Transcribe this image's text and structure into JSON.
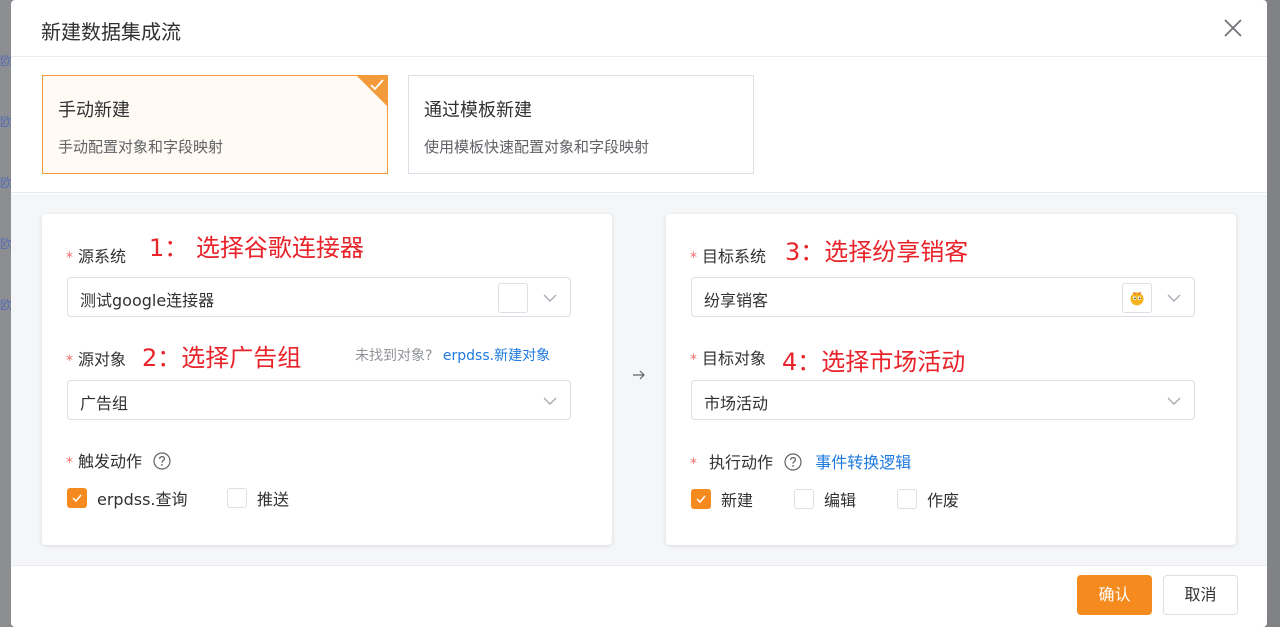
{
  "modal": {
    "title": "新建数据集成流"
  },
  "background_chars": [
    "欧",
    "欧",
    "欧",
    "欧",
    "欧"
  ],
  "modes": [
    {
      "title": "手动新建",
      "desc": "手动配置对象和字段映射",
      "selected": true
    },
    {
      "title": "通过模板新建",
      "desc": "使用模板快速配置对象和字段映射",
      "selected": false
    }
  ],
  "source": {
    "system_label": "源系统",
    "system_annotation": "1： 选择谷歌连接器",
    "system_value": "测试google连接器",
    "object_label": "源对象",
    "object_annotation": "2：选择广告组",
    "object_hint": "未找到对象?",
    "object_link": "erpdss.新建对象",
    "object_value": "广告组",
    "trigger_label": "触发动作",
    "trigger_options": [
      {
        "label": "erpdss.查询",
        "checked": true
      },
      {
        "label": "推送",
        "checked": false
      }
    ]
  },
  "target": {
    "system_label": "目标系统",
    "system_annotation": "3：选择纷享销客",
    "system_value": "纷享销客",
    "object_label": "目标对象",
    "object_annotation": "4：选择市场活动",
    "object_value": "市场活动",
    "action_label": "执行动作",
    "action_link": "事件转换逻辑",
    "action_options": [
      {
        "label": "新建",
        "checked": true
      },
      {
        "label": "编辑",
        "checked": false
      },
      {
        "label": "作废",
        "checked": false
      }
    ]
  },
  "footer": {
    "confirm_label": "确认",
    "cancel_label": "取消"
  },
  "colors": {
    "accent": "#f58a1f",
    "annotation": "#e8232a",
    "link": "#1f7ae0",
    "required": "#f56c6c"
  }
}
